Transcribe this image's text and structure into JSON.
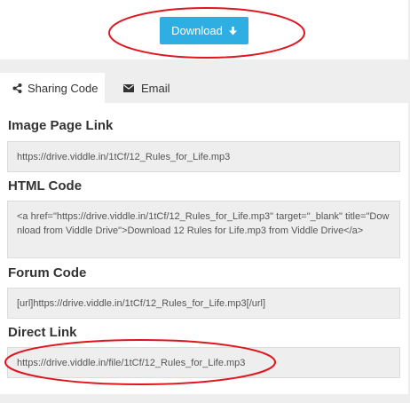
{
  "download": {
    "label": "Download",
    "icon": "download-arrow-icon",
    "color": "#2eaee3"
  },
  "tabs": [
    {
      "label": "Sharing Code",
      "icon": "share-icon",
      "active": true
    },
    {
      "label": "Email",
      "icon": "envelope-icon",
      "active": false
    }
  ],
  "sections": {
    "image_page_link": {
      "title": "Image Page Link",
      "value": "https://drive.viddle.in/1tCf/12_Rules_for_Life.mp3"
    },
    "html_code": {
      "title": "HTML Code",
      "value": "<a href=\"https://drive.viddle.in/1tCf/12_Rules_for_Life.mp3\" target=\"_blank\" title=\"Download from Viddle Drive\">Download 12 Rules for Life.mp3 from Viddle Drive</a>"
    },
    "forum_code": {
      "title": "Forum Code",
      "value": "[url]https://drive.viddle.in/1tCf/12_Rules_for_Life.mp3[/url]"
    },
    "direct_link": {
      "title": "Direct Link",
      "value": "https://drive.viddle.in/file/1tCf/12_Rules_for_Life.mp3"
    }
  },
  "annotations": {
    "color": "#e0161f"
  }
}
